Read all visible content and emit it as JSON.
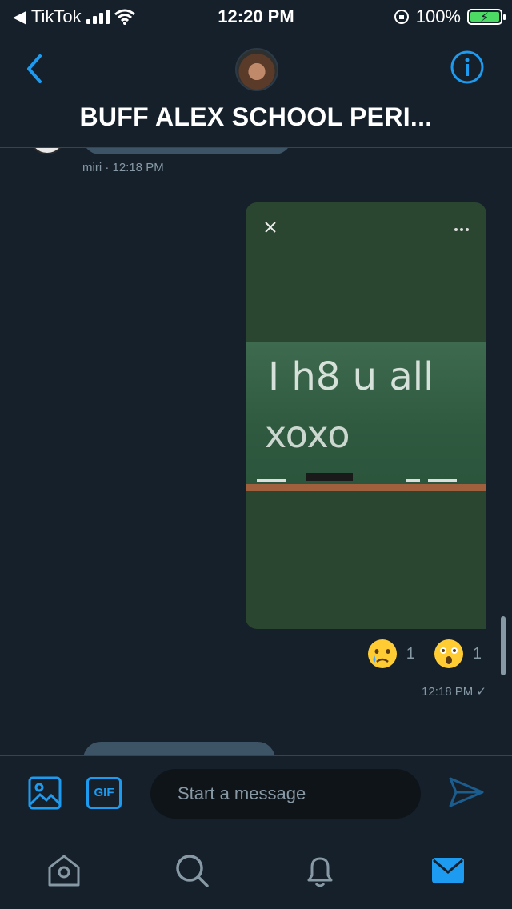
{
  "status_bar": {
    "back_app": "TikTok",
    "time": "12:20 PM",
    "battery": "100%"
  },
  "header": {
    "title": "BUFF ALEX SCHOOL PERI..."
  },
  "messages": [
    {
      "sender": "miri",
      "time": "· 12:18 PM"
    },
    {
      "media_text": [
        "I h8 u all",
        "xoxo"
      ],
      "reactions": [
        {
          "emoji": "crying-face",
          "count": "1"
        },
        {
          "emoji": "astonished-face",
          "count": "1"
        }
      ],
      "time": "12:18 PM ✓"
    }
  ],
  "composer": {
    "gif_label": "GIF",
    "placeholder": "Start a message"
  },
  "colors": {
    "background": "#15202b",
    "accent": "#1d9bf0",
    "muted": "#8899a6",
    "bubble": "#3d5466"
  },
  "tabs": [
    "home",
    "search",
    "notifications",
    "messages"
  ]
}
